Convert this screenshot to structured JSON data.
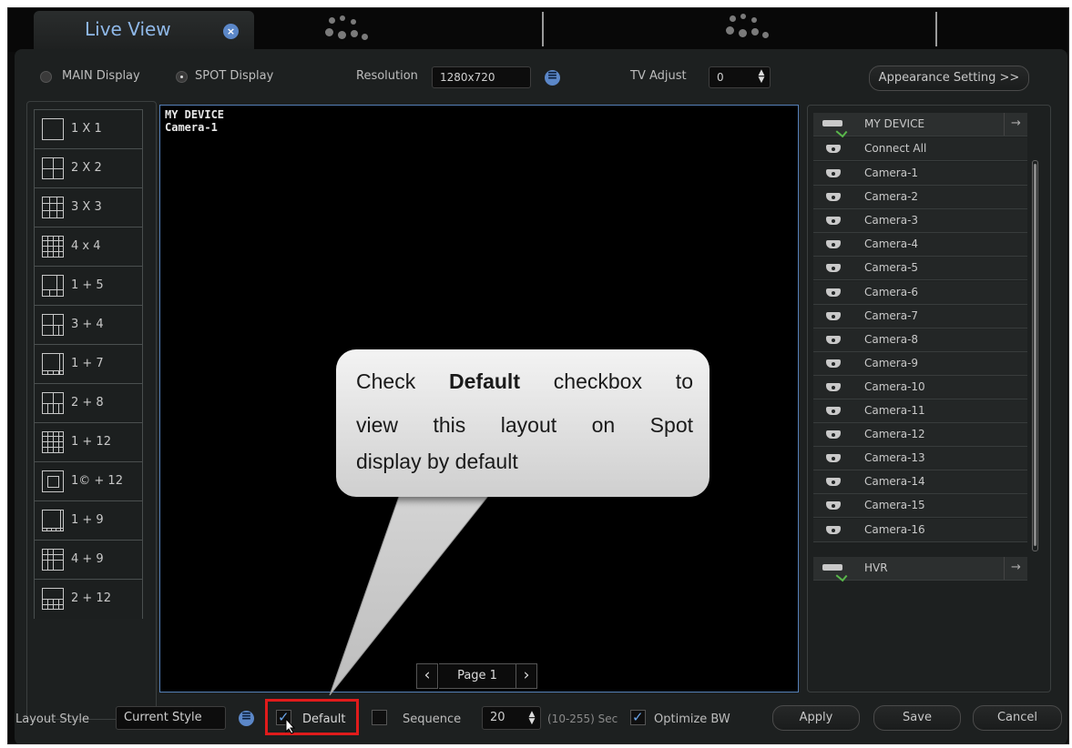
{
  "tabs": {
    "active_label": "Live View"
  },
  "display_options": {
    "main_display_label": "MAIN Display",
    "spot_display_label": "SPOT Display",
    "selected": "SPOT Display",
    "resolution_label": "Resolution",
    "resolution_value": "1280x720",
    "tv_adjust_label": "TV Adjust",
    "tv_adjust_value": "0",
    "appearance_button": "Appearance Setting >>"
  },
  "layouts": [
    {
      "label": "1 X 1",
      "icon": "layout-1x1-icon"
    },
    {
      "label": "2 X 2",
      "icon": "layout-2x2-icon"
    },
    {
      "label": "3 X 3",
      "icon": "layout-3x3-icon"
    },
    {
      "label": "4 x 4",
      "icon": "layout-4x4-icon"
    },
    {
      "label": "1 + 5",
      "icon": "layout-1-plus-5-icon"
    },
    {
      "label": "3 + 4",
      "icon": "layout-3-plus-4-icon"
    },
    {
      "label": "1 + 7",
      "icon": "layout-1-plus-7-icon"
    },
    {
      "label": "2 + 8",
      "icon": "layout-2-plus-8-icon"
    },
    {
      "label": "1 + 12",
      "icon": "layout-1-plus-12-icon"
    },
    {
      "label": "1© + 12",
      "icon": "layout-1c-plus-12-icon"
    },
    {
      "label": "1 + 9",
      "icon": "layout-1-plus-9-icon"
    },
    {
      "label": "4 + 9",
      "icon": "layout-4-plus-9-icon"
    },
    {
      "label": "2 + 12",
      "icon": "layout-2-plus-12-icon"
    }
  ],
  "video": {
    "device_name": "MY DEVICE",
    "camera_name": "Camera-1",
    "page_label": "Page 1"
  },
  "callout": {
    "line1_before": "Check ",
    "line1_bold": "Default",
    "line1_after": " checkbox to",
    "line2": "view this layout on Spot",
    "line3": "display by default"
  },
  "device_tree": {
    "device_label": "MY DEVICE",
    "connect_all_label": "Connect All",
    "cameras": [
      "Camera-1",
      "Camera-2",
      "Camera-3",
      "Camera-4",
      "Camera-5",
      "Camera-6",
      "Camera-7",
      "Camera-8",
      "Camera-9",
      "Camera-10",
      "Camera-11",
      "Camera-12",
      "Camera-13",
      "Camera-14",
      "Camera-15",
      "Camera-16"
    ],
    "hvr_label": "HVR"
  },
  "bottom_bar": {
    "layout_style_label": "Layout Style",
    "layout_style_value": "Current Style",
    "default_label": "Default",
    "default_checked": true,
    "sequence_label": "Sequence",
    "sequence_checked": false,
    "sequence_value": "20",
    "sequence_range": "(10-255) Sec",
    "optimize_label": "Optimize BW",
    "optimize_checked": true,
    "apply_label": "Apply",
    "save_label": "Save",
    "cancel_label": "Cancel"
  },
  "colors": {
    "accent_blue": "#5b87c8",
    "highlight_red": "#e01b1b",
    "check_green": "#59b84b"
  }
}
